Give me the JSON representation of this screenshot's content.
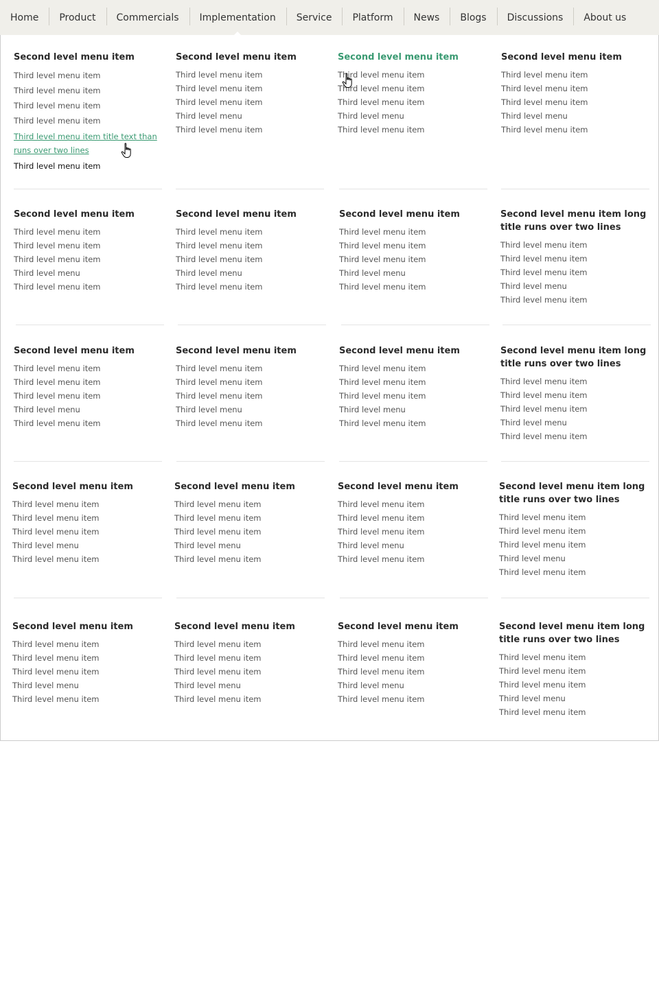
{
  "nav": {
    "items": [
      "Home",
      "Product",
      "Commercials",
      "Implementation",
      "Service",
      "Platform",
      "News",
      "Blogs",
      "Discussions",
      "About us"
    ],
    "active_index": 3
  },
  "menu": {
    "row1": [
      {
        "heading": "Second level menu item",
        "items": [
          "Third level menu item",
          "Third level menu item",
          "Third level menu item",
          "Third level menu item",
          "Third level menu item title text than runs over two lines",
          "Third level menu item"
        ]
      },
      {
        "heading": "Second level menu item",
        "items": [
          "Third level menu item",
          "Third level menu item",
          "Third level menu item",
          "Third level menu",
          "Third level menu item"
        ]
      },
      {
        "heading": "Second level menu item",
        "items": [
          "Third level menu item",
          "Third level menu item",
          "Third level menu item",
          "Third level menu",
          "Third level menu item"
        ]
      },
      {
        "heading": "Second level menu item",
        "items": [
          "Third level menu item",
          "Third level menu item",
          "Third level menu item",
          "Third level menu",
          "Third level menu item"
        ]
      }
    ],
    "row2": [
      {
        "heading": "Second level menu item",
        "items": [
          "Third level menu item",
          "Third level menu item",
          "Third level menu item",
          "Third level menu",
          "Third level menu item"
        ]
      },
      {
        "heading": "Second level menu item",
        "items": [
          "Third level menu item",
          "Third level menu item",
          "Third level menu item",
          "Third level menu",
          "Third level menu item"
        ]
      },
      {
        "heading": "Second level menu item",
        "items": [
          "Third level menu item",
          "Third level menu item",
          "Third level menu item",
          "Third level menu",
          "Third level menu item"
        ]
      },
      {
        "heading": "Second level menu item long title runs over two lines",
        "items": [
          "Third level menu item",
          "Third level menu item",
          "Third level menu item",
          "Third level menu",
          "Third level menu item"
        ]
      }
    ],
    "row3": [
      {
        "heading": "Second level menu item",
        "items": [
          "Third level menu item",
          "Third level menu item",
          "Third level menu item",
          "Third level menu",
          "Third level menu item"
        ]
      },
      {
        "heading": "Second level menu item",
        "items": [
          "Third level menu item",
          "Third level menu item",
          "Third level menu item",
          "Third level menu",
          "Third level menu item"
        ]
      },
      {
        "heading": "Second level menu item",
        "items": [
          "Third level menu item",
          "Third level menu item",
          "Third level menu item",
          "Third level menu",
          "Third level menu item"
        ]
      },
      {
        "heading": "Second level menu item long title runs over two lines",
        "items": [
          "Third level menu item",
          "Third level menu item",
          "Third level menu item",
          "Third level menu",
          "Third level menu item"
        ]
      }
    ],
    "row4": [
      {
        "heading": "Second level menu item",
        "items": [
          "Third level menu item",
          "Third level menu item",
          "Third level menu item",
          "Third level menu",
          "Third level menu item"
        ]
      },
      {
        "heading": "Second level menu item",
        "items": [
          "Third level menu item",
          "Third level menu item",
          "Third level menu item",
          "Third level menu",
          "Third level menu item"
        ]
      },
      {
        "heading": "Second level menu item",
        "items": [
          "Third level menu item",
          "Third level menu item",
          "Third level menu item",
          "Third level menu",
          "Third level menu item"
        ]
      },
      {
        "heading": "Second level menu item long title runs over two lines",
        "items": [
          "Third level menu item",
          "Third level menu item",
          "Third level menu item",
          "Third level menu",
          "Third level menu item"
        ]
      }
    ],
    "row5": [
      {
        "heading": "Second level menu item",
        "items": [
          "Third level menu item",
          "Third level menu item",
          "Third level menu item",
          "Third level menu",
          "Third level menu item"
        ]
      },
      {
        "heading": "Second level menu item",
        "items": [
          "Third level menu item",
          "Third level menu item",
          "Third level menu item",
          "Third level menu",
          "Third level menu item"
        ]
      },
      {
        "heading": "Second level menu item",
        "items": [
          "Third level menu item",
          "Third level menu item",
          "Third level menu item",
          "Third level menu",
          "Third level menu item"
        ]
      },
      {
        "heading": "Second level menu item long title runs over two lines",
        "items": [
          "Third level menu item",
          "Third level menu item",
          "Third level menu item",
          "Third level menu",
          "Third level menu item"
        ]
      }
    ]
  },
  "colors": {
    "accent_green": "#3a9a72",
    "nav_background": "#f0efea",
    "text_dark": "#2b2b2b",
    "text_muted": "#555555"
  },
  "icons": {
    "cursor": "hand-pointer-icon"
  }
}
